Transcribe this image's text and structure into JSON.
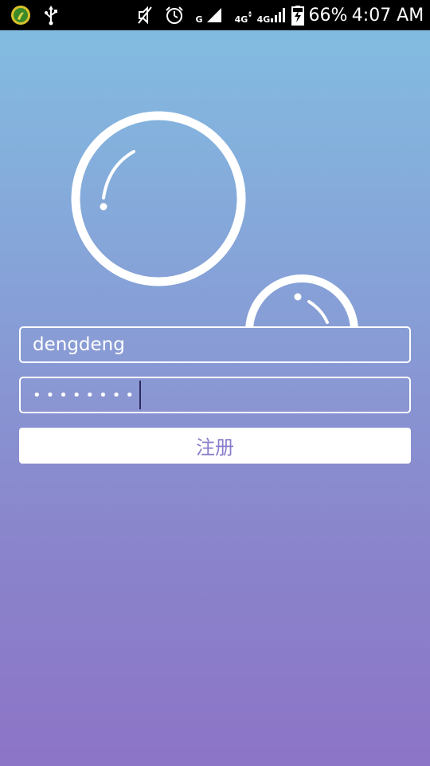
{
  "status_bar": {
    "icons": [
      "app-notification-icon",
      "usb-icon",
      "mute-icon",
      "alarm-icon",
      "signal-icon",
      "signal-icon",
      "signal-icon",
      "battery-charging-icon"
    ],
    "network_1": "G",
    "network_2": "4G",
    "network_3": "4G",
    "battery_percent": "66%",
    "time": "4:07 AM"
  },
  "form": {
    "username_value": "dengdeng",
    "password_masked": "••••••••",
    "register_label": "注册"
  },
  "colors": {
    "gradient_top": "#82bfe2",
    "gradient_bottom": "#8c74c6",
    "button_text": "#8a7ecc",
    "status_bar_bg": "#000000"
  }
}
